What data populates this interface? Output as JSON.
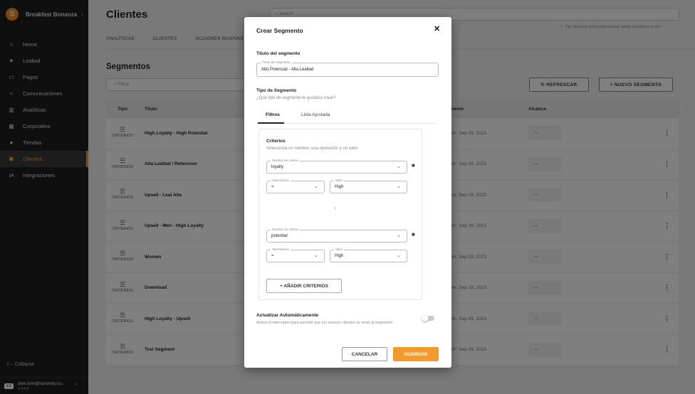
{
  "sidebar": {
    "brand": {
      "logo": "S",
      "name": "Breakfast Bonanza",
      "chevron": "›"
    },
    "items": [
      {
        "icon": "home-icon",
        "glyph": "⌂",
        "label": "Home"
      },
      {
        "icon": "loyalty-icon",
        "glyph": "♥",
        "label": "Lealtad"
      },
      {
        "icon": "payments-icon",
        "glyph": "▭",
        "label": "Pagos"
      },
      {
        "icon": "communications-icon",
        "glyph": "≈",
        "label": "Comunicaciones"
      },
      {
        "icon": "analytics-icon",
        "glyph": "▥",
        "label": "Analíticas"
      },
      {
        "icon": "corporate-icon",
        "glyph": "▦",
        "label": "Corporativo"
      },
      {
        "icon": "stores-icon",
        "glyph": "●",
        "label": "Tiendas"
      },
      {
        "icon": "clients-icon",
        "glyph": "☗",
        "label": "Clientes",
        "active": true
      },
      {
        "icon": "integrations-icon",
        "glyph": "⇄",
        "label": "Integraciones"
      }
    ],
    "collapse": "I← Collapse",
    "user": {
      "lang": "ES",
      "email": "jose.torio@spoonity.co...",
      "version": "v 4.4.2"
    }
  },
  "header": {
    "title": "Clientes",
    "search_placeholder": "Search",
    "tip": "Tip: Use una coma para buscar varias cuentas a la vez"
  },
  "tabs": [
    "ANALÍTICAS",
    "CLIENTES",
    "ACCIONES MASIVAS"
  ],
  "segments": {
    "title": "Segmentos",
    "filter_placeholder": "Filtrar",
    "refresh": "REFRESCAR",
    "new_segment": "+ NUEVO SEGMENTO",
    "columns": {
      "tipo": "Tipo",
      "titulo": "Título",
      "date": "mente",
      "alcance": "Alcance"
    },
    "rows": [
      {
        "tipo": "CRITERIOS",
        "title": "High Loyalty - High Potential",
        "date": "ión: Sep 29, 2023",
        "alcance": "---"
      },
      {
        "tipo": "CRITERIOS",
        "title": "Alta Lealtad / Retencion",
        "date": "ión: Sep 29, 2023",
        "alcance": "---"
      },
      {
        "tipo": "CRITERIOS",
        "title": "Upsell - Leal Alta",
        "date": "ión: Sep 29, 2023",
        "alcance": "---"
      },
      {
        "tipo": "CRITERIOS",
        "title": "Upsell - Men - High Loyalty",
        "date": "ión: Sep 29, 2023",
        "alcance": "---"
      },
      {
        "tipo": "CRITERIOS",
        "title": "Women",
        "date": "ión: Sep 29, 2023",
        "alcance": "---"
      },
      {
        "tipo": "CRITERIOS",
        "title": "Download",
        "date": "ión: Sep 29, 2023",
        "alcance": "---"
      },
      {
        "tipo": "CRITERIOS",
        "title": "High Loyalty - Upsell",
        "date": "ión: Sep 29, 2023",
        "alcance": "---"
      },
      {
        "tipo": "CRITERIOS",
        "title": "Test Segment",
        "date": "ión: Sep 29, 2023",
        "alcance": "---"
      }
    ]
  },
  "modal": {
    "title": "Crear Segmento",
    "close": "✕",
    "segment_title_label": "Título del segmento",
    "segment_title_field_label": "Título del segmento",
    "segment_title_value": "Alto Potencial - Alta Lealtad",
    "type_label": "Tipo de Segmento",
    "type_question": "¿Qué tipo de segmento te gustaría crear?",
    "tabs": [
      "Filtros",
      "Lista Ajustada"
    ],
    "criteria": {
      "title": "Criterios",
      "subtitle": "Selecciona un nombre, una operación y un valor",
      "name_label": "Nombre de criterio",
      "op_label": "Operadores",
      "value_label": "Valor",
      "items": [
        {
          "name": "loyalty",
          "op": "=",
          "value": "High"
        },
        {
          "name": "potential",
          "op": "=",
          "value": "High"
        }
      ],
      "connector": "Y",
      "add": "+ AÑADIR CRITERIOS"
    },
    "auto_update": {
      "label": "Actualizar Automáticamente",
      "description": "Activa el interruptor para permitir que los nuevos clientes se unan al segmento",
      "on": false
    },
    "cancel": "CANCELAR",
    "save": "GUARDAR"
  },
  "colors": {
    "accent": "#f29a2e",
    "sidebar_bg": "#1e1e1e",
    "overlay": "rgba(0,0,0,0.5)"
  }
}
